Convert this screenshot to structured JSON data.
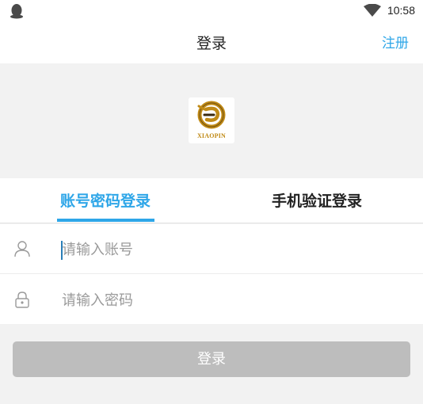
{
  "status_bar": {
    "time": "10:58",
    "left_icon": "qq-penguin-icon",
    "wifi_icon": "wifi-icon"
  },
  "header": {
    "title": "登录",
    "register_label": "注册"
  },
  "logo": {
    "text": "XIAOPIN",
    "colors": {
      "gold": "#c08a16",
      "dark": "#3a2a10"
    }
  },
  "tabs": [
    {
      "label": "账号密码登录",
      "active": true
    },
    {
      "label": "手机验证登录",
      "active": false
    }
  ],
  "form": {
    "account": {
      "placeholder": "请输入账号",
      "value": "",
      "icon": "user-icon"
    },
    "password": {
      "placeholder": "请输入密码",
      "value": "",
      "icon": "lock-icon"
    }
  },
  "login_button": {
    "label": "登录"
  },
  "colors": {
    "accent": "#2ea6e8",
    "button_disabled": "#bdbdbd",
    "background": "#f2f2f2"
  }
}
